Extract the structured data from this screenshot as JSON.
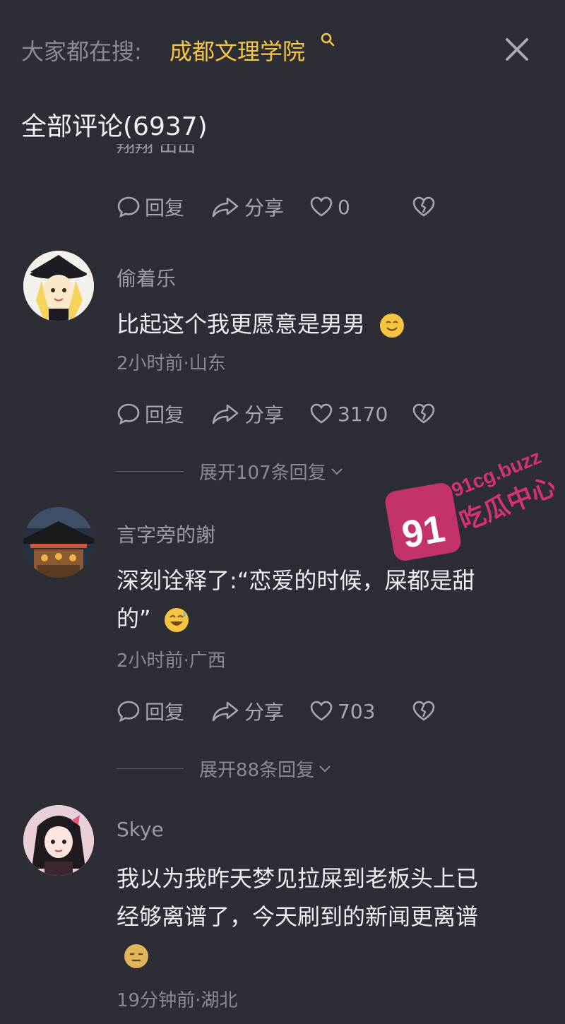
{
  "header": {
    "search_prefix": "大家都在搜:",
    "search_term": "成都文理学院",
    "search_icon": "search-icon",
    "close_icon": "close-icon"
  },
  "comments_title": "全部评论(6937)",
  "partial_comment": {
    "text_fragment": "翔翔 出出",
    "actions": {
      "reply": "回复",
      "share": "分享",
      "likes": "0"
    }
  },
  "comments": [
    {
      "username": "偷着乐",
      "text": "比起这个我更愿意是男男",
      "emoji": "smile-emoji",
      "meta": "2小时前·山东",
      "actions": {
        "reply": "回复",
        "share": "分享",
        "likes": "3170"
      },
      "expand": "展开107条回复"
    },
    {
      "username": "言字旁的謝",
      "text_line1": "深刻诠释了:“恋爱的时候，屎都是甜",
      "text_line2": "的”",
      "emoji": "laugh-sweat-emoji",
      "meta": "2小时前·广西",
      "actions": {
        "reply": "回复",
        "share": "分享",
        "likes": "703"
      },
      "expand": "展开88条回复"
    },
    {
      "username": "Skye",
      "text_line1": "我以为我昨天梦见拉屎到老板头上已",
      "text_line2": "经够离谱了，今天刷到的新闻更离谱",
      "emoji": "speechless-emoji",
      "meta": "19分钟前·湖北"
    }
  ],
  "watermark": {
    "badge_number": "91",
    "site": "91cg.buzz",
    "name": "吃瓜中心"
  },
  "colors": {
    "background": "#2d2d36",
    "accent_yellow": "#f3c744",
    "watermark_pink": "#d4336f"
  }
}
